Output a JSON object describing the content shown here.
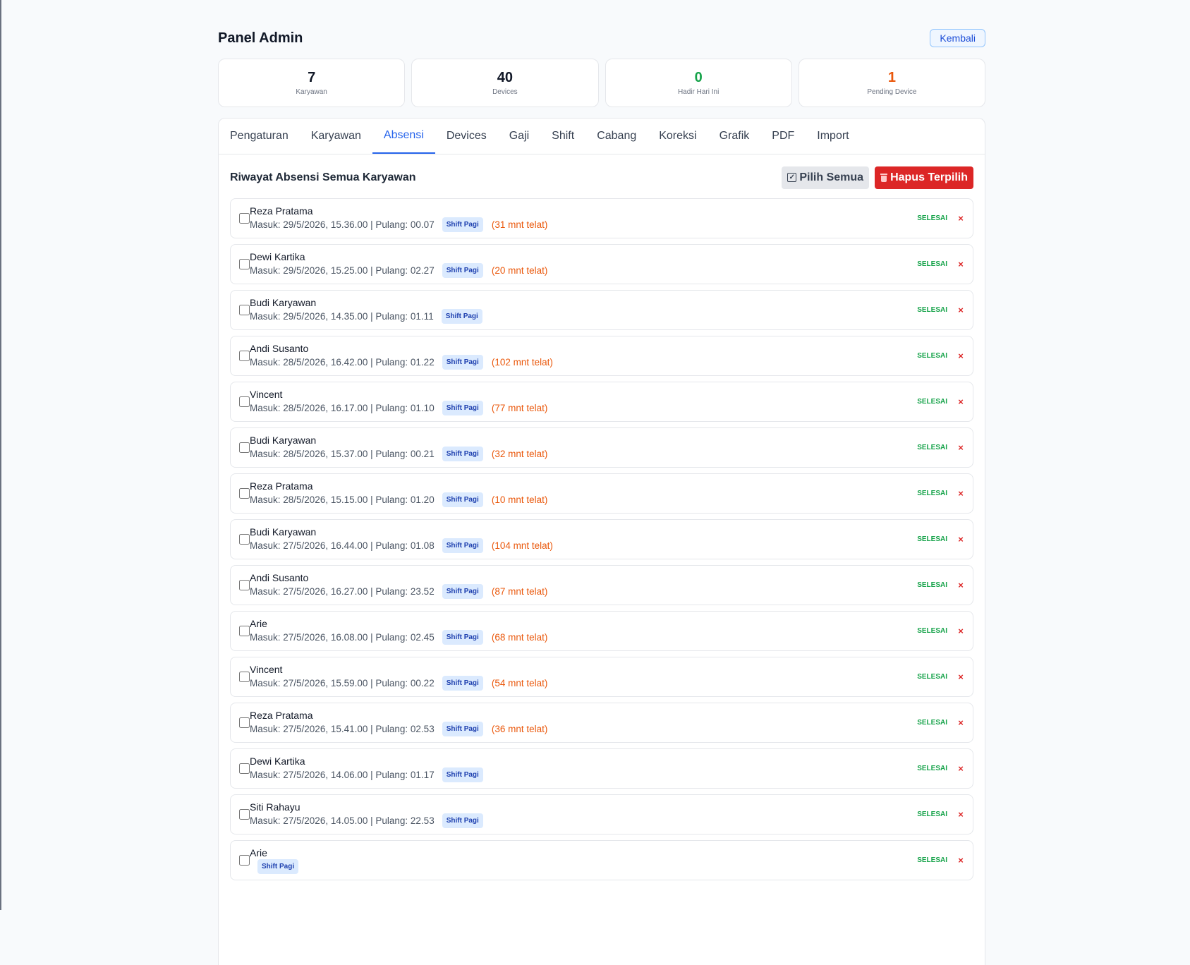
{
  "header": {
    "title": "Panel Admin",
    "back_label": "Kembali"
  },
  "stats": [
    {
      "value": "7",
      "label": "Karyawan",
      "color": "#111827"
    },
    {
      "value": "40",
      "label": "Devices",
      "color": "#111827"
    },
    {
      "value": "0",
      "label": "Hadir Hari Ini",
      "color": "#16a34a"
    },
    {
      "value": "1",
      "label": "Pending Device",
      "color": "#ea580c"
    }
  ],
  "tabs": [
    "Pengaturan",
    "Karyawan",
    "Absensi",
    "Devices",
    "Gaji",
    "Shift",
    "Cabang",
    "Koreksi",
    "Grafik",
    "PDF",
    "Import"
  ],
  "active_tab": "Absensi",
  "section": {
    "title": "Riwayat Absensi Semua Karyawan",
    "select_all_label": "Pilih Semua",
    "delete_selected_label": "Hapus Terpilih"
  },
  "records": [
    {
      "name": "Reza Pratama",
      "detail": "Masuk: 29/5/2026, 15.36.00 | Pulang: 00.07",
      "shift": "Shift Pagi",
      "late": "(31 mnt telat)",
      "status": "SELESAI"
    },
    {
      "name": "Dewi Kartika",
      "detail": "Masuk: 29/5/2026, 15.25.00 | Pulang: 02.27",
      "shift": "Shift Pagi",
      "late": "(20 mnt telat)",
      "status": "SELESAI"
    },
    {
      "name": "Budi Karyawan",
      "detail": "Masuk: 29/5/2026, 14.35.00 | Pulang: 01.11",
      "shift": "Shift Pagi",
      "late": "",
      "status": "SELESAI"
    },
    {
      "name": "Andi Susanto",
      "detail": "Masuk: 28/5/2026, 16.42.00 | Pulang: 01.22",
      "shift": "Shift Pagi",
      "late": "(102 mnt telat)",
      "status": "SELESAI"
    },
    {
      "name": "Vincent",
      "detail": "Masuk: 28/5/2026, 16.17.00 | Pulang: 01.10",
      "shift": "Shift Pagi",
      "late": "(77 mnt telat)",
      "status": "SELESAI"
    },
    {
      "name": "Budi Karyawan",
      "detail": "Masuk: 28/5/2026, 15.37.00 | Pulang: 00.21",
      "shift": "Shift Pagi",
      "late": "(32 mnt telat)",
      "status": "SELESAI"
    },
    {
      "name": "Reza Pratama",
      "detail": "Masuk: 28/5/2026, 15.15.00 | Pulang: 01.20",
      "shift": "Shift Pagi",
      "late": "(10 mnt telat)",
      "status": "SELESAI"
    },
    {
      "name": "Budi Karyawan",
      "detail": "Masuk: 27/5/2026, 16.44.00 | Pulang: 01.08",
      "shift": "Shift Pagi",
      "late": "(104 mnt telat)",
      "status": "SELESAI"
    },
    {
      "name": "Andi Susanto",
      "detail": "Masuk: 27/5/2026, 16.27.00 | Pulang: 23.52",
      "shift": "Shift Pagi",
      "late": "(87 mnt telat)",
      "status": "SELESAI"
    },
    {
      "name": "Arie",
      "detail": "Masuk: 27/5/2026, 16.08.00 | Pulang: 02.45",
      "shift": "Shift Pagi",
      "late": "(68 mnt telat)",
      "status": "SELESAI"
    },
    {
      "name": "Vincent",
      "detail": "Masuk: 27/5/2026, 15.59.00 | Pulang: 00.22",
      "shift": "Shift Pagi",
      "late": "(54 mnt telat)",
      "status": "SELESAI"
    },
    {
      "name": "Reza Pratama",
      "detail": "Masuk: 27/5/2026, 15.41.00 | Pulang: 02.53",
      "shift": "Shift Pagi",
      "late": "(36 mnt telat)",
      "status": "SELESAI"
    },
    {
      "name": "Dewi Kartika",
      "detail": "Masuk: 27/5/2026, 14.06.00 | Pulang: 01.17",
      "shift": "Shift Pagi",
      "late": "",
      "status": "SELESAI"
    },
    {
      "name": "Siti Rahayu",
      "detail": "Masuk: 27/5/2026, 14.05.00 | Pulang: 22.53",
      "shift": "Shift Pagi",
      "late": "",
      "status": "SELESAI"
    },
    {
      "name": "Arie",
      "detail": "",
      "shift": "Shift Pagi",
      "late": "",
      "status": "SELESAI"
    }
  ],
  "icons": {
    "select_all": "checkbox-icon",
    "delete_selected": "trash-icon",
    "row_delete": "close-icon"
  },
  "colors": {
    "accent": "#2563eb",
    "danger": "#dc2626",
    "success": "#16a34a",
    "warning": "#ea580c",
    "badge_bg": "#dbeafe"
  }
}
